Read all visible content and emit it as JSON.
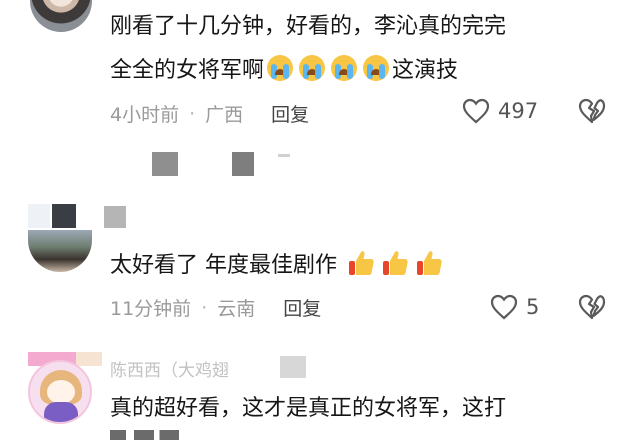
{
  "comments": [
    {
      "line1": "刚看了十几分钟，好看的，李沁真的完完",
      "line2_text": "全全的女将军啊",
      "line2_tail": "这演技",
      "emoji_count": 4,
      "time": "4小时前",
      "location": "广西",
      "reply_label": "回复",
      "likes": "497"
    },
    {
      "username": "",
      "text": "太好看了 年度最佳剧作",
      "emoji_count": 3,
      "time": "11分钟前",
      "location": "云南",
      "reply_label": "回复",
      "likes": "5"
    },
    {
      "username": "陈西西（大鸡翅",
      "line1": "真的超好看，这才是真正的女将军，这打"
    }
  ],
  "icons": {
    "like": "heart-outline-icon",
    "dislike": "broken-heart-icon",
    "cry_emoji": "loudly-crying-face-emoji",
    "thumb_emoji": "thumbs-up-emoji"
  },
  "colors": {
    "text": "#161616",
    "meta": "#9a9a9a",
    "reply": "#444444",
    "emoji_yellow": "#f7c644"
  }
}
